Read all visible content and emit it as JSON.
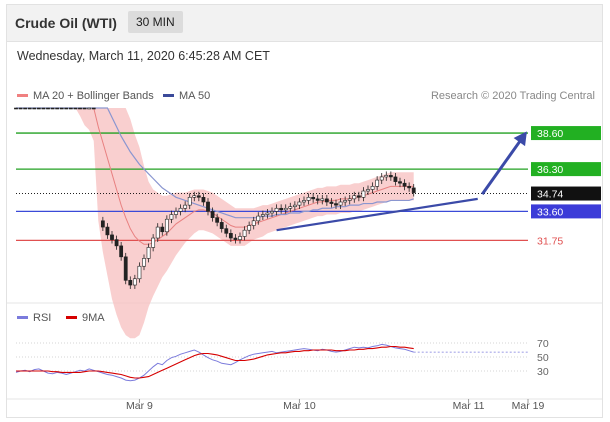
{
  "header": {
    "title": "Crude Oil (WTI)",
    "timeframe": "30 MIN"
  },
  "datetime": "Wednesday, March 11, 2020 6:45:28 AM CET",
  "legend": {
    "ma20_label": "MA 20 + Bollinger Bands",
    "ma20_color": "#f08080",
    "ma50_label": "MA 50",
    "ma50_color": "#3b4a9a",
    "credit": "Research © 2020 Trading Central"
  },
  "rsi_legend": {
    "rsi_label": "RSI",
    "rsi_color": "#7b7bdc",
    "ma_label": "9MA",
    "ma_color": "#d60000"
  },
  "chart_data": [
    {
      "type": "candlestick",
      "ylim": [
        28.2,
        40.2
      ],
      "levels": [
        {
          "value": 38.6,
          "label": "38.60",
          "color": "#22a022",
          "label_bg": "#22b022"
        },
        {
          "value": 36.3,
          "label": "36.30",
          "color": "#22a022",
          "label_bg": "#22b022"
        },
        {
          "value": 34.74,
          "label": "34.74",
          "color": "#000000",
          "label_bg": "#111111"
        },
        {
          "value": 33.6,
          "label": "33.60",
          "color": "#3b4ad8",
          "label_bg": "#3b3bd8"
        },
        {
          "value": 31.75,
          "label": "31.75",
          "color": "#e05050",
          "label_bg": ""
        }
      ],
      "close_series": [
        45.4,
        45.3,
        45.2,
        45.0,
        44.9,
        44.6,
        44.4,
        44.0,
        43.6,
        43.5,
        43.3,
        42.8,
        42.2,
        41.8,
        41.6,
        41.2,
        41.5,
        41.1,
        33.0,
        32.6,
        32.1,
        31.8,
        31.4,
        30.7,
        29.2,
        28.9,
        29.3,
        30.1,
        30.6,
        31.3,
        31.9,
        32.6,
        32.3,
        33.1,
        33.4,
        33.6,
        33.8,
        34.0,
        34.5,
        34.6,
        34.5,
        34.2,
        33.6,
        33.2,
        32.9,
        32.5,
        32.2,
        31.9,
        31.8,
        32.0,
        32.4,
        32.7,
        33.0,
        33.3,
        33.4,
        33.5,
        33.6,
        33.8,
        33.7,
        33.8,
        33.9,
        34.0,
        34.2,
        34.3,
        34.5,
        34.4,
        34.3,
        34.4,
        34.2,
        34.1,
        34.0,
        34.2,
        34.3,
        34.4,
        34.6,
        34.5,
        34.9,
        35.0,
        35.2,
        35.6,
        35.8,
        35.9,
        35.8,
        35.5,
        35.4,
        35.2,
        35.1,
        34.8
      ],
      "ma20_series": [
        45.5,
        45.4,
        45.3,
        45.1,
        44.9,
        44.7,
        44.4,
        44.1,
        43.8,
        43.5,
        43.1,
        42.7,
        42.3,
        41.9,
        41.5,
        41.0,
        40.8,
        40.4,
        39.0,
        38.0,
        37.0,
        36.0,
        35.0,
        34.0,
        33.2,
        32.5,
        32.0,
        31.7,
        31.5,
        31.5,
        31.6,
        31.8,
        32.0,
        32.2,
        32.5,
        32.8,
        33.0,
        33.2,
        33.4,
        33.6,
        33.7,
        33.7,
        33.6,
        33.5,
        33.3,
        33.1,
        32.9,
        32.7,
        32.6,
        32.6,
        32.6,
        32.7,
        32.8,
        32.9,
        33.0,
        33.1,
        33.2,
        33.3,
        33.4,
        33.5,
        33.6,
        33.7,
        33.8,
        33.9,
        34.0,
        34.1,
        34.2,
        34.2,
        34.3,
        34.3,
        34.3,
        34.4,
        34.4,
        34.4,
        34.5,
        34.5,
        34.6,
        34.7,
        34.8,
        34.9,
        35.0,
        35.1,
        35.2,
        35.2,
        35.2,
        35.2,
        35.2,
        35.2
      ],
      "bollinger_width": [
        0.8,
        0.8,
        0.8,
        0.9,
        0.9,
        1.0,
        1.0,
        1.1,
        1.2,
        1.3,
        1.4,
        1.5,
        1.6,
        1.7,
        1.8,
        1.9,
        2.0,
        2.3,
        6.0,
        7.0,
        7.5,
        8.0,
        8.0,
        7.8,
        7.5,
        7.0,
        6.5,
        6.0,
        5.0,
        4.0,
        3.4,
        3.0,
        2.6,
        2.4,
        2.2,
        2.0,
        1.8,
        1.6,
        1.5,
        1.4,
        1.3,
        1.3,
        1.3,
        1.3,
        1.3,
        1.3,
        1.3,
        1.3,
        1.2,
        1.2,
        1.2,
        1.1,
        1.0,
        1.0,
        1.0,
        0.9,
        0.9,
        0.9,
        0.9,
        0.9,
        0.9,
        0.9,
        0.9,
        0.9,
        0.9,
        0.9,
        0.9,
        0.9,
        0.9,
        0.9,
        0.9,
        0.9,
        0.9,
        0.9,
        0.9,
        0.9,
        0.9,
        0.9,
        0.9,
        0.9,
        0.9,
        0.9,
        0.9,
        0.9,
        0.9,
        0.9,
        0.9,
        0.9
      ],
      "ma50_series": [
        45.8,
        45.7,
        45.6,
        45.5,
        45.4,
        45.3,
        45.2,
        45.0,
        44.8,
        44.6,
        44.3,
        44.0,
        43.7,
        43.4,
        43.1,
        42.8,
        42.6,
        42.4,
        41.4,
        40.8,
        40.2,
        39.6,
        39.0,
        38.4,
        37.9,
        37.4,
        37.0,
        36.6,
        36.3,
        36.0,
        35.7,
        35.4,
        35.1,
        34.9,
        34.7,
        34.5,
        34.4,
        34.3,
        34.2,
        34.1,
        34.0,
        33.9,
        33.8,
        33.7,
        33.6,
        33.5,
        33.4,
        33.3,
        33.2,
        33.2,
        33.2,
        33.2,
        33.2,
        33.2,
        33.3,
        33.3,
        33.3,
        33.4,
        33.4,
        33.4,
        33.5,
        33.5,
        33.5,
        33.6,
        33.6,
        33.7,
        33.7,
        33.8,
        33.8,
        33.8,
        33.9,
        33.9,
        33.9,
        34.0,
        34.0,
        34.0,
        34.1,
        34.1,
        34.1,
        34.2,
        34.2,
        34.2,
        34.3,
        34.3,
        34.3,
        34.3,
        34.3,
        34.4
      ],
      "trendline": {
        "from": 32.4,
        "to": 34.4
      },
      "projection": {
        "from": 34.7,
        "to": 38.6
      }
    },
    {
      "type": "line",
      "name": "RSI",
      "ylim": [
        0,
        100
      ],
      "yticks": [
        70,
        50,
        30
      ],
      "rsi": [
        28,
        30,
        31,
        29,
        32,
        33,
        30,
        27,
        26,
        28,
        27,
        25,
        27,
        29,
        31,
        30,
        33,
        31,
        29,
        27,
        25,
        24,
        22,
        20,
        17,
        16,
        17,
        20,
        24,
        30,
        36,
        41,
        39,
        45,
        49,
        51,
        54,
        56,
        58,
        60,
        57,
        53,
        49,
        46,
        44,
        41,
        40,
        39,
        42,
        46,
        49,
        52,
        54,
        55,
        56,
        57,
        58,
        56,
        57,
        58,
        59,
        60,
        61,
        62,
        61,
        60,
        59,
        61,
        60,
        58,
        57,
        58,
        60,
        62,
        64,
        63,
        64,
        63,
        65,
        66,
        68,
        67,
        65,
        63,
        62,
        61,
        59,
        57
      ],
      "ma9": [
        30,
        30,
        30,
        30,
        30,
        30,
        30,
        30,
        29,
        29,
        28,
        28,
        28,
        28,
        28,
        29,
        30,
        30,
        30,
        29,
        28,
        27,
        26,
        25,
        23,
        21,
        20,
        20,
        21,
        22,
        25,
        28,
        31,
        34,
        37,
        40,
        43,
        46,
        49,
        52,
        54,
        55,
        55,
        54,
        53,
        51,
        49,
        47,
        45,
        45,
        45,
        46,
        47,
        49,
        51,
        53,
        54,
        55,
        56,
        56,
        57,
        58,
        58,
        59,
        59,
        60,
        60,
        60,
        60,
        60,
        59,
        59,
        59,
        60,
        60,
        61,
        61,
        62,
        62,
        63,
        64,
        64,
        65,
        65,
        64,
        64,
        63,
        62
      ]
    }
  ],
  "x_axis": {
    "ticks": [
      {
        "label": "Mar 9",
        "index": 27
      },
      {
        "label": "Mar 10",
        "index": 62
      },
      {
        "label": "Mar 11",
        "index": 99
      },
      {
        "label": "Mar 19",
        "index": 112
      }
    ]
  }
}
